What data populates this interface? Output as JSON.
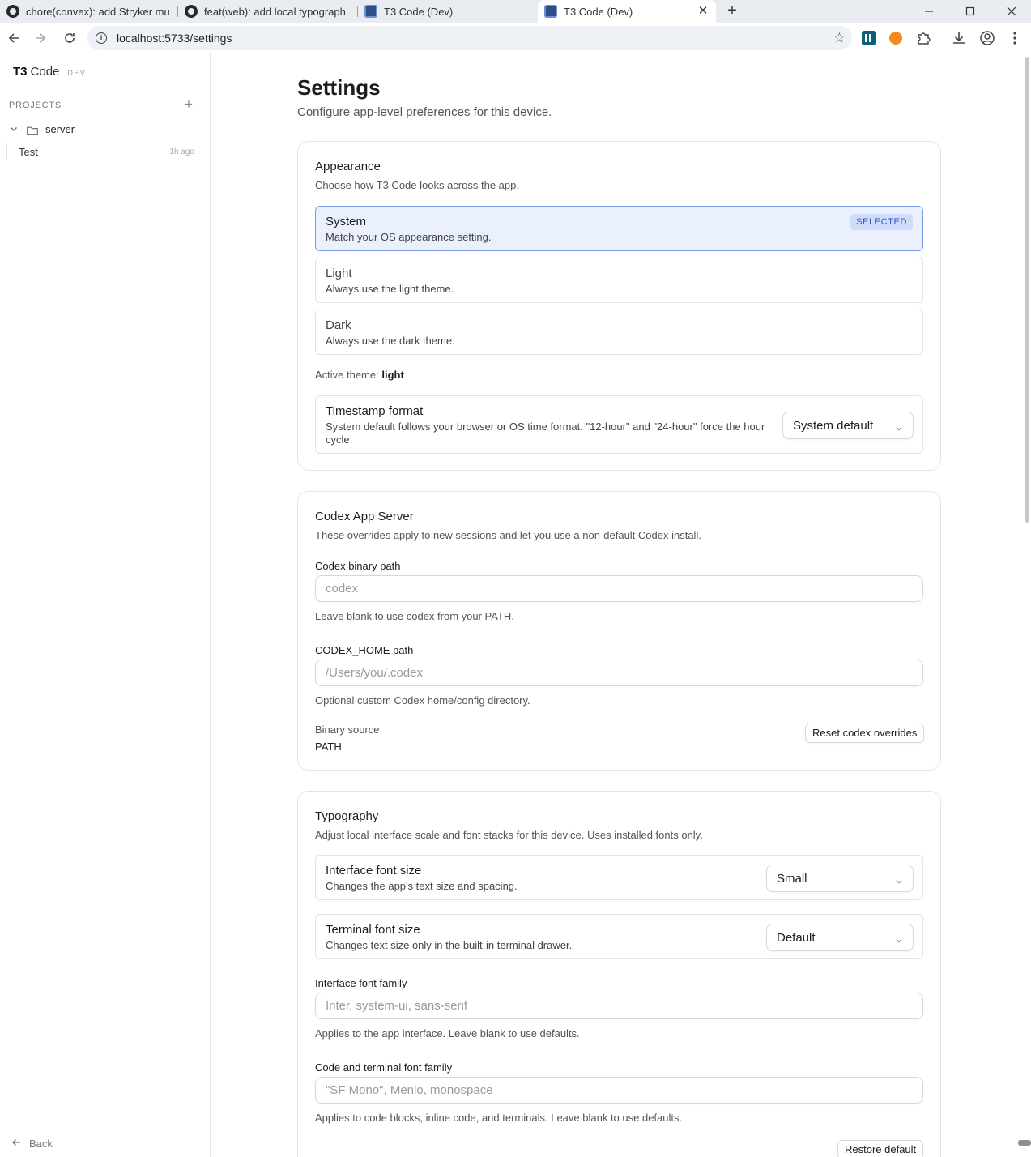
{
  "browser": {
    "tabs": [
      {
        "title": "chore(convex): add Stryker mu",
        "icon": "github-icon"
      },
      {
        "title": "feat(web): add local typograph",
        "icon": "github-icon"
      },
      {
        "title": "T3 Code (Dev)",
        "icon": "t3-favicon-icon"
      },
      {
        "title": "T3 Code (Dev)",
        "icon": "t3-favicon-icon",
        "active": true
      }
    ],
    "url": "localhost:5733/settings"
  },
  "sidebar": {
    "brand": "T3",
    "brand_suffix": "Code",
    "env_badge": "DEV",
    "projects_label": "PROJECTS",
    "project": {
      "name": "server",
      "expanded": true
    },
    "thread": {
      "title": "Test",
      "time": "1h ago"
    },
    "back_label": "Back"
  },
  "page": {
    "title": "Settings",
    "subtitle": "Configure app-level preferences for this device."
  },
  "appearance": {
    "title": "Appearance",
    "description": "Choose how T3 Code looks across the app.",
    "options": [
      {
        "title": "System",
        "description": "Match your OS appearance setting.",
        "selected": true
      },
      {
        "title": "Light",
        "description": "Always use the light theme.",
        "selected": false
      },
      {
        "title": "Dark",
        "description": "Always use the dark theme.",
        "selected": false
      }
    ],
    "selected_badge": "SELECTED",
    "active_theme_label": "Active theme:",
    "active_theme_value": "light",
    "timestamp": {
      "title": "Timestamp format",
      "description": "System default follows your browser or OS time format. \"12-hour\" and \"24-hour\" force the hour cycle.",
      "value": "System default"
    }
  },
  "codex": {
    "title": "Codex App Server",
    "description": "These overrides apply to new sessions and let you use a non-default Codex install.",
    "binary_label": "Codex binary path",
    "binary_value": "",
    "binary_placeholder": "codex",
    "binary_help": "Leave blank to use codex from your PATH.",
    "home_label": "CODEX_HOME path",
    "home_value": "",
    "home_placeholder": "/Users/you/.codex",
    "home_help": "Optional custom Codex home/config directory.",
    "source_label": "Binary source",
    "source_value": "PATH",
    "reset_label": "Reset codex overrides"
  },
  "typography": {
    "title": "Typography",
    "description": "Adjust local interface scale and font stacks for this device. Uses installed fonts only.",
    "interface_size": {
      "title": "Interface font size",
      "description": "Changes the app's text size and spacing.",
      "value": "Small"
    },
    "terminal_size": {
      "title": "Terminal font size",
      "description": "Changes text size only in the built-in terminal drawer.",
      "value": "Default"
    },
    "interface_family_label": "Interface font family",
    "interface_family_value": "",
    "interface_family_placeholder": "Inter, system-ui, sans-serif",
    "interface_family_help": "Applies to the app interface. Leave blank to use defaults.",
    "code_family_label": "Code and terminal font family",
    "code_family_value": "",
    "code_family_placeholder": "\"SF Mono\", Menlo, monospace",
    "code_family_help": "Applies to code blocks, inline code, and terminals. Leave blank to use defaults.",
    "restore_label": "Restore default"
  },
  "colors": {
    "accent": "#2f55c8",
    "selected_bg": "#ebf0fd",
    "selected_border": "#7b9ae8"
  }
}
